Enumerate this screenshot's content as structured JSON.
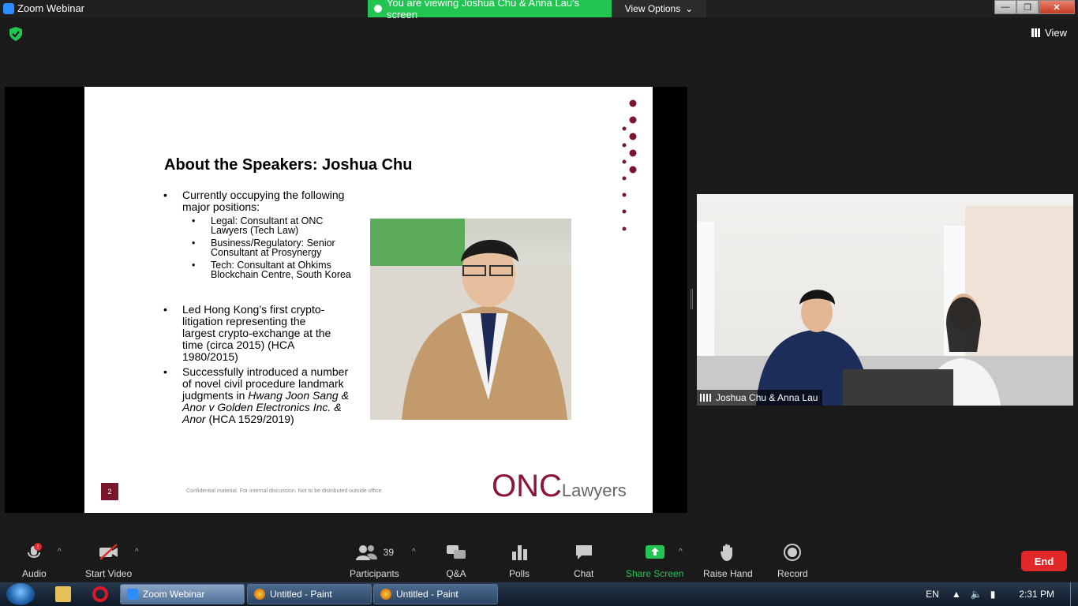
{
  "window": {
    "title": "Zoom Webinar",
    "minimize": "—",
    "maximize": "❐",
    "close": "✕"
  },
  "banner": {
    "viewing": "You are viewing Joshua Chu & Anna Lau's screen",
    "view_options": "View Options"
  },
  "view_label": "View",
  "slide": {
    "title": "About the Speakers: Joshua Chu",
    "bullet1": "Currently occupying the following major positions:",
    "sub1": "Legal: Consultant at ONC Lawyers (Tech Law)",
    "sub2": "Business/Regulatory: Senior Consultant at Prosynergy",
    "sub3": "Tech: Consultant at Ohkims Blockchain Centre, South Korea",
    "bullet2": "Led Hong Kong’s first crypto-litigation representing the largest crypto-exchange at the time (circa 2015) (HCA 1980/2015)",
    "bullet3_pre": "Successfully introduced a number of novel civil procedure landmark judgments in ",
    "bullet3_case": "Hwang Joon Sang & Anor v Golden Electronics Inc. & Anor",
    "bullet3_post": " (HCA 1529/2019)",
    "page_number": "2",
    "confidential": "Confidential material. For internal discussion. Not to be distributed outside office.",
    "logo_main": "ONC",
    "logo_sub": "Lawyers",
    "accent_color": "#7a1530"
  },
  "video": {
    "name": "Joshua Chu & Anna Lau"
  },
  "toolbar": {
    "audio": "Audio",
    "start_video": "Start Video",
    "participants": "Participants",
    "participants_count": "39",
    "qa": "Q&A",
    "polls": "Polls",
    "chat": "Chat",
    "share_screen": "Share Screen",
    "raise_hand": "Raise Hand",
    "record": "Record",
    "end": "End"
  },
  "taskbar": {
    "zoom": "Zoom Webinar",
    "paint1": "Untitled - Paint",
    "paint2": "Untitled - Paint",
    "lang": "EN",
    "time": "2:31 PM"
  }
}
